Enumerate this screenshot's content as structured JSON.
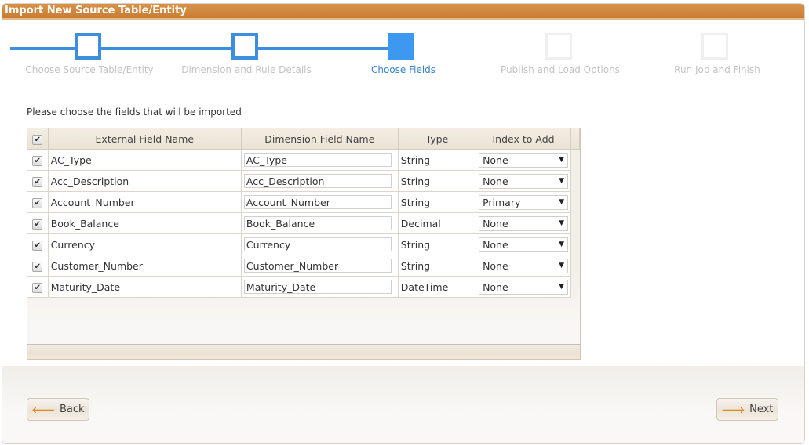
{
  "dialog": {
    "title": "Import New Source Table/Entity"
  },
  "wizard": {
    "steps": [
      {
        "label": "Choose Source Table/Entity",
        "state": "completed"
      },
      {
        "label": "Dimension and Rule Details",
        "state": "completed"
      },
      {
        "label": "Choose Fields",
        "state": "active"
      },
      {
        "label": "Publish and Load Options",
        "state": "future"
      },
      {
        "label": "Run Job and Finish",
        "state": "future"
      }
    ],
    "colors": {
      "completed": "#3d8fde",
      "active": "#3d98f0",
      "future": "#efefef"
    }
  },
  "instructions": "Please choose the fields that will be imported",
  "grid": {
    "select_all_checked": true,
    "columns": [
      "External Field Name",
      "Dimension Field Name",
      "Type",
      "Index to Add"
    ],
    "rows": [
      {
        "checked": true,
        "external": "AC_Type",
        "dimension": "AC_Type",
        "type": "String",
        "index": "None"
      },
      {
        "checked": true,
        "external": "Acc_Description",
        "dimension": "Acc_Description",
        "type": "String",
        "index": "None"
      },
      {
        "checked": true,
        "external": "Account_Number",
        "dimension": "Account_Number",
        "type": "String",
        "index": "Primary"
      },
      {
        "checked": true,
        "external": "Book_Balance",
        "dimension": "Book_Balance",
        "type": "Decimal",
        "index": "None"
      },
      {
        "checked": true,
        "external": "Currency",
        "dimension": "Currency",
        "type": "String",
        "index": "None"
      },
      {
        "checked": true,
        "external": "Customer_Number",
        "dimension": "Customer_Number",
        "type": "String",
        "index": "None"
      },
      {
        "checked": true,
        "external": "Maturity_Date",
        "dimension": "Maturity_Date",
        "type": "DateTime",
        "index": "None"
      }
    ]
  },
  "icons": {
    "checkbox": "✔",
    "dropdown": "▼",
    "back": "🡐",
    "next": "🡒"
  },
  "buttons": {
    "back": "Back",
    "next": "Next"
  },
  "colors": {
    "title_bar": "#c97d33",
    "accent": "#3d8fde",
    "button_arrow": "#e08a1e"
  }
}
